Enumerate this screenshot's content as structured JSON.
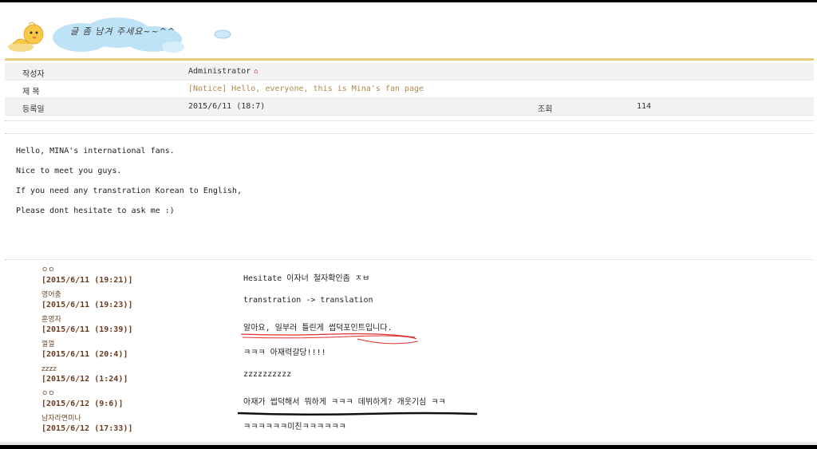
{
  "banner": {
    "text": "글 좀 남겨 주세요~~^^"
  },
  "post": {
    "author_label": "작성자",
    "author": "Administrator",
    "subject_label": "제 목",
    "subject": "[Notice] Hello, everyone, this is Mina's fan page",
    "date_label": "등록일",
    "date": "2015/6/11 (18:7)",
    "views_label": "조회",
    "views": "114",
    "body": [
      "Hello, MINA's international fans.",
      "Nice to meet you guys.",
      "If you need any transtration Korean to English,",
      "Please dont hesitate to ask me :)"
    ]
  },
  "comments": [
    {
      "author": "ㅇㅇ",
      "date": "[2015/6/11 (19:21)]",
      "text": "Hesitate 이자너 철자확인좀 ㅈㅂ"
    },
    {
      "author": "영어충",
      "date": "[2015/6/11 (19:23)]",
      "text": "transtration -> translation"
    },
    {
      "author": "훈영자",
      "date": "[2015/6/11 (19:39)]",
      "text": "알아요, 일부러 틀린게 썹덕포인트입니다."
    },
    {
      "author": "껄껄",
      "date": "[2015/6/11 (20:4)]",
      "text": "ㅋㅋㅋ 아재력갈당!!!!"
    },
    {
      "author": "zzzz",
      "date": "[2015/6/12 (1:24)]",
      "text": "zzzzzzzzzz"
    },
    {
      "author": "ㅇㅇ",
      "date": "[2015/6/12 (9:6)]",
      "text": "아재가 썹덕해서 뭐하게 ㅋㅋㅋ 데뷔하게? 개웃기심 ㅋㅋ"
    },
    {
      "author": "남자라면미나",
      "date": "[2015/6/12 (17:33)]",
      "text": "ㅋㅋㅋㅋㅋㅋ미친ㅋㅋㅋㅋㅋㅋ"
    }
  ],
  "colors": {
    "header_line": "#e6cb79",
    "subject": "#b2874b",
    "comment_date": "#6b3b1f",
    "red_mark": "#e03030",
    "black_mark": "#111111"
  }
}
